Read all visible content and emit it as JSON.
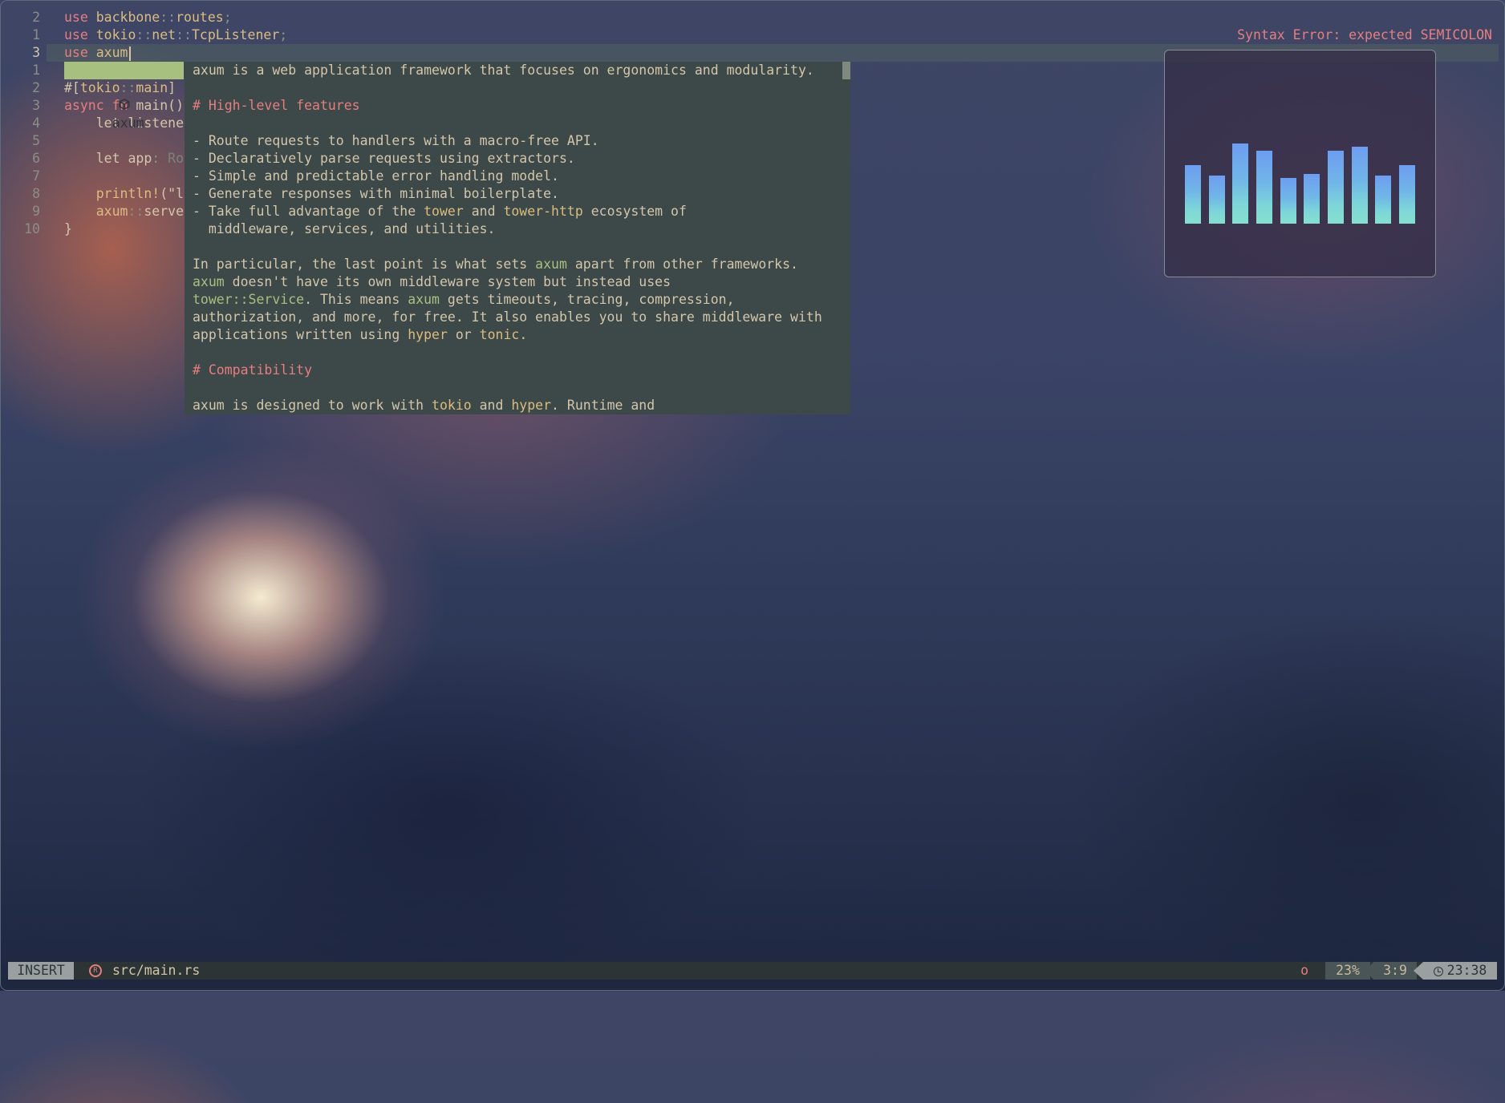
{
  "editor": {
    "lines": [
      {
        "num": "2",
        "tokens": [
          {
            "c": "kw",
            "t": "use "
          },
          {
            "c": "pth",
            "t": "backbone"
          },
          {
            "c": "op",
            "t": "::"
          },
          {
            "c": "pth",
            "t": "routes"
          },
          {
            "c": "op",
            "t": ";"
          }
        ]
      },
      {
        "num": "1",
        "tokens": [
          {
            "c": "kw",
            "t": "use "
          },
          {
            "c": "pth",
            "t": "tokio"
          },
          {
            "c": "op",
            "t": "::"
          },
          {
            "c": "pth",
            "t": "net"
          },
          {
            "c": "op",
            "t": "::"
          },
          {
            "c": "pth",
            "t": "TcpListener"
          },
          {
            "c": "op",
            "t": ";"
          }
        ]
      },
      {
        "num": "3",
        "current": true,
        "tokens": [
          {
            "c": "kw",
            "t": "use "
          },
          {
            "c": "pth",
            "t": "axum"
          }
        ]
      },
      {
        "num": "1",
        "tokens": []
      },
      {
        "num": "2",
        "tokens": [
          {
            "c": "pl",
            "t": "#["
          },
          {
            "c": "pth",
            "t": "tokio"
          },
          {
            "c": "op",
            "t": "::"
          },
          {
            "c": "pth",
            "t": "main"
          },
          {
            "c": "pl",
            "t": "]"
          }
        ]
      },
      {
        "num": "3",
        "tokens": [
          {
            "c": "kw",
            "t": "async fn "
          },
          {
            "c": "pl",
            "t": "main()"
          }
        ]
      },
      {
        "num": "4",
        "tokens": [
          {
            "c": "pl",
            "t": "    let listene"
          }
        ]
      },
      {
        "num": "5",
        "tokens": []
      },
      {
        "num": "6",
        "tokens": [
          {
            "c": "pl",
            "t": "    let app"
          },
          {
            "c": "op",
            "t": ": "
          },
          {
            "c": "dim",
            "t": "Ro"
          }
        ]
      },
      {
        "num": "7",
        "tokens": []
      },
      {
        "num": "8",
        "tokens": [
          {
            "c": "mac",
            "t": "    println!"
          },
          {
            "c": "pl",
            "t": "(\"l"
          }
        ]
      },
      {
        "num": "9",
        "tokens": [
          {
            "c": "pth",
            "t": "    axum"
          },
          {
            "c": "op",
            "t": "::"
          },
          {
            "c": "pl",
            "t": "serve"
          }
        ]
      },
      {
        "num": "10",
        "tokens": [
          {
            "c": "pl",
            "t": "}"
          }
        ]
      }
    ],
    "diagnostic": "Syntax Error: expected SEMICOLON"
  },
  "completion": {
    "icon": "package-icon",
    "label": "axum"
  },
  "docs": {
    "lines": [
      [
        {
          "c": "t",
          "t": "axum is a web application framework that focuses on ergonomics and modularity."
        }
      ],
      [],
      [
        {
          "c": "h",
          "t": "# High-level features"
        }
      ],
      [],
      [
        {
          "c": "t",
          "t": "- Route requests to handlers with a macro-free API."
        }
      ],
      [
        {
          "c": "t",
          "t": "- Declaratively parse requests using extractors."
        }
      ],
      [
        {
          "c": "t",
          "t": "- Simple and predictable error handling model."
        }
      ],
      [
        {
          "c": "t",
          "t": "- Generate responses with minimal boilerplate."
        }
      ],
      [
        {
          "c": "t",
          "t": "- Take full advantage of the "
        },
        {
          "c": "lk",
          "t": "tower"
        },
        {
          "c": "t",
          "t": " and "
        },
        {
          "c": "lk",
          "t": "tower-http"
        },
        {
          "c": "t",
          "t": " ecosystem of"
        }
      ],
      [
        {
          "c": "t",
          "t": "  middleware, services, and utilities."
        }
      ],
      [],
      [
        {
          "c": "t",
          "t": "In particular, the last point is what sets "
        },
        {
          "c": "gn",
          "t": "axum"
        },
        {
          "c": "t",
          "t": " apart from other frameworks."
        }
      ],
      [
        {
          "c": "gn",
          "t": "axum"
        },
        {
          "c": "t",
          "t": " doesn't have its own middleware system but instead uses"
        }
      ],
      [
        {
          "c": "gn",
          "t": "tower::Service"
        },
        {
          "c": "t",
          "t": ". This means "
        },
        {
          "c": "gn",
          "t": "axum"
        },
        {
          "c": "t",
          "t": " gets timeouts, tracing, compression,"
        }
      ],
      [
        {
          "c": "t",
          "t": "authorization, and more, for free. It also enables you to share middleware with"
        }
      ],
      [
        {
          "c": "t",
          "t": "applications written using "
        },
        {
          "c": "lk",
          "t": "hyper"
        },
        {
          "c": "t",
          "t": " or "
        },
        {
          "c": "lk",
          "t": "tonic"
        },
        {
          "c": "t",
          "t": "."
        }
      ],
      [],
      [
        {
          "c": "h",
          "t": "# Compatibility"
        }
      ],
      [],
      [
        {
          "c": "t",
          "t": "axum is designed to work with "
        },
        {
          "c": "lk",
          "t": "tokio"
        },
        {
          "c": "t",
          "t": " and "
        },
        {
          "c": "lk",
          "t": "hyper"
        },
        {
          "c": "t",
          "t": ". Runtime and"
        }
      ]
    ]
  },
  "visualizer": {
    "levels": [
      0.58,
      0.48,
      0.79,
      0.72,
      0.45,
      0.49,
      0.72,
      0.76,
      0.48,
      0.58
    ]
  },
  "statusbar": {
    "mode": "INSERT",
    "file_icon": "rust-icon",
    "file_icon_glyph": "R",
    "file_name": "src/main.rs",
    "diagnostic_indicator": "o",
    "scroll_percent": "23%",
    "cursor_position": "3:9",
    "clock_icon": "clock-icon",
    "time": "23:38"
  }
}
